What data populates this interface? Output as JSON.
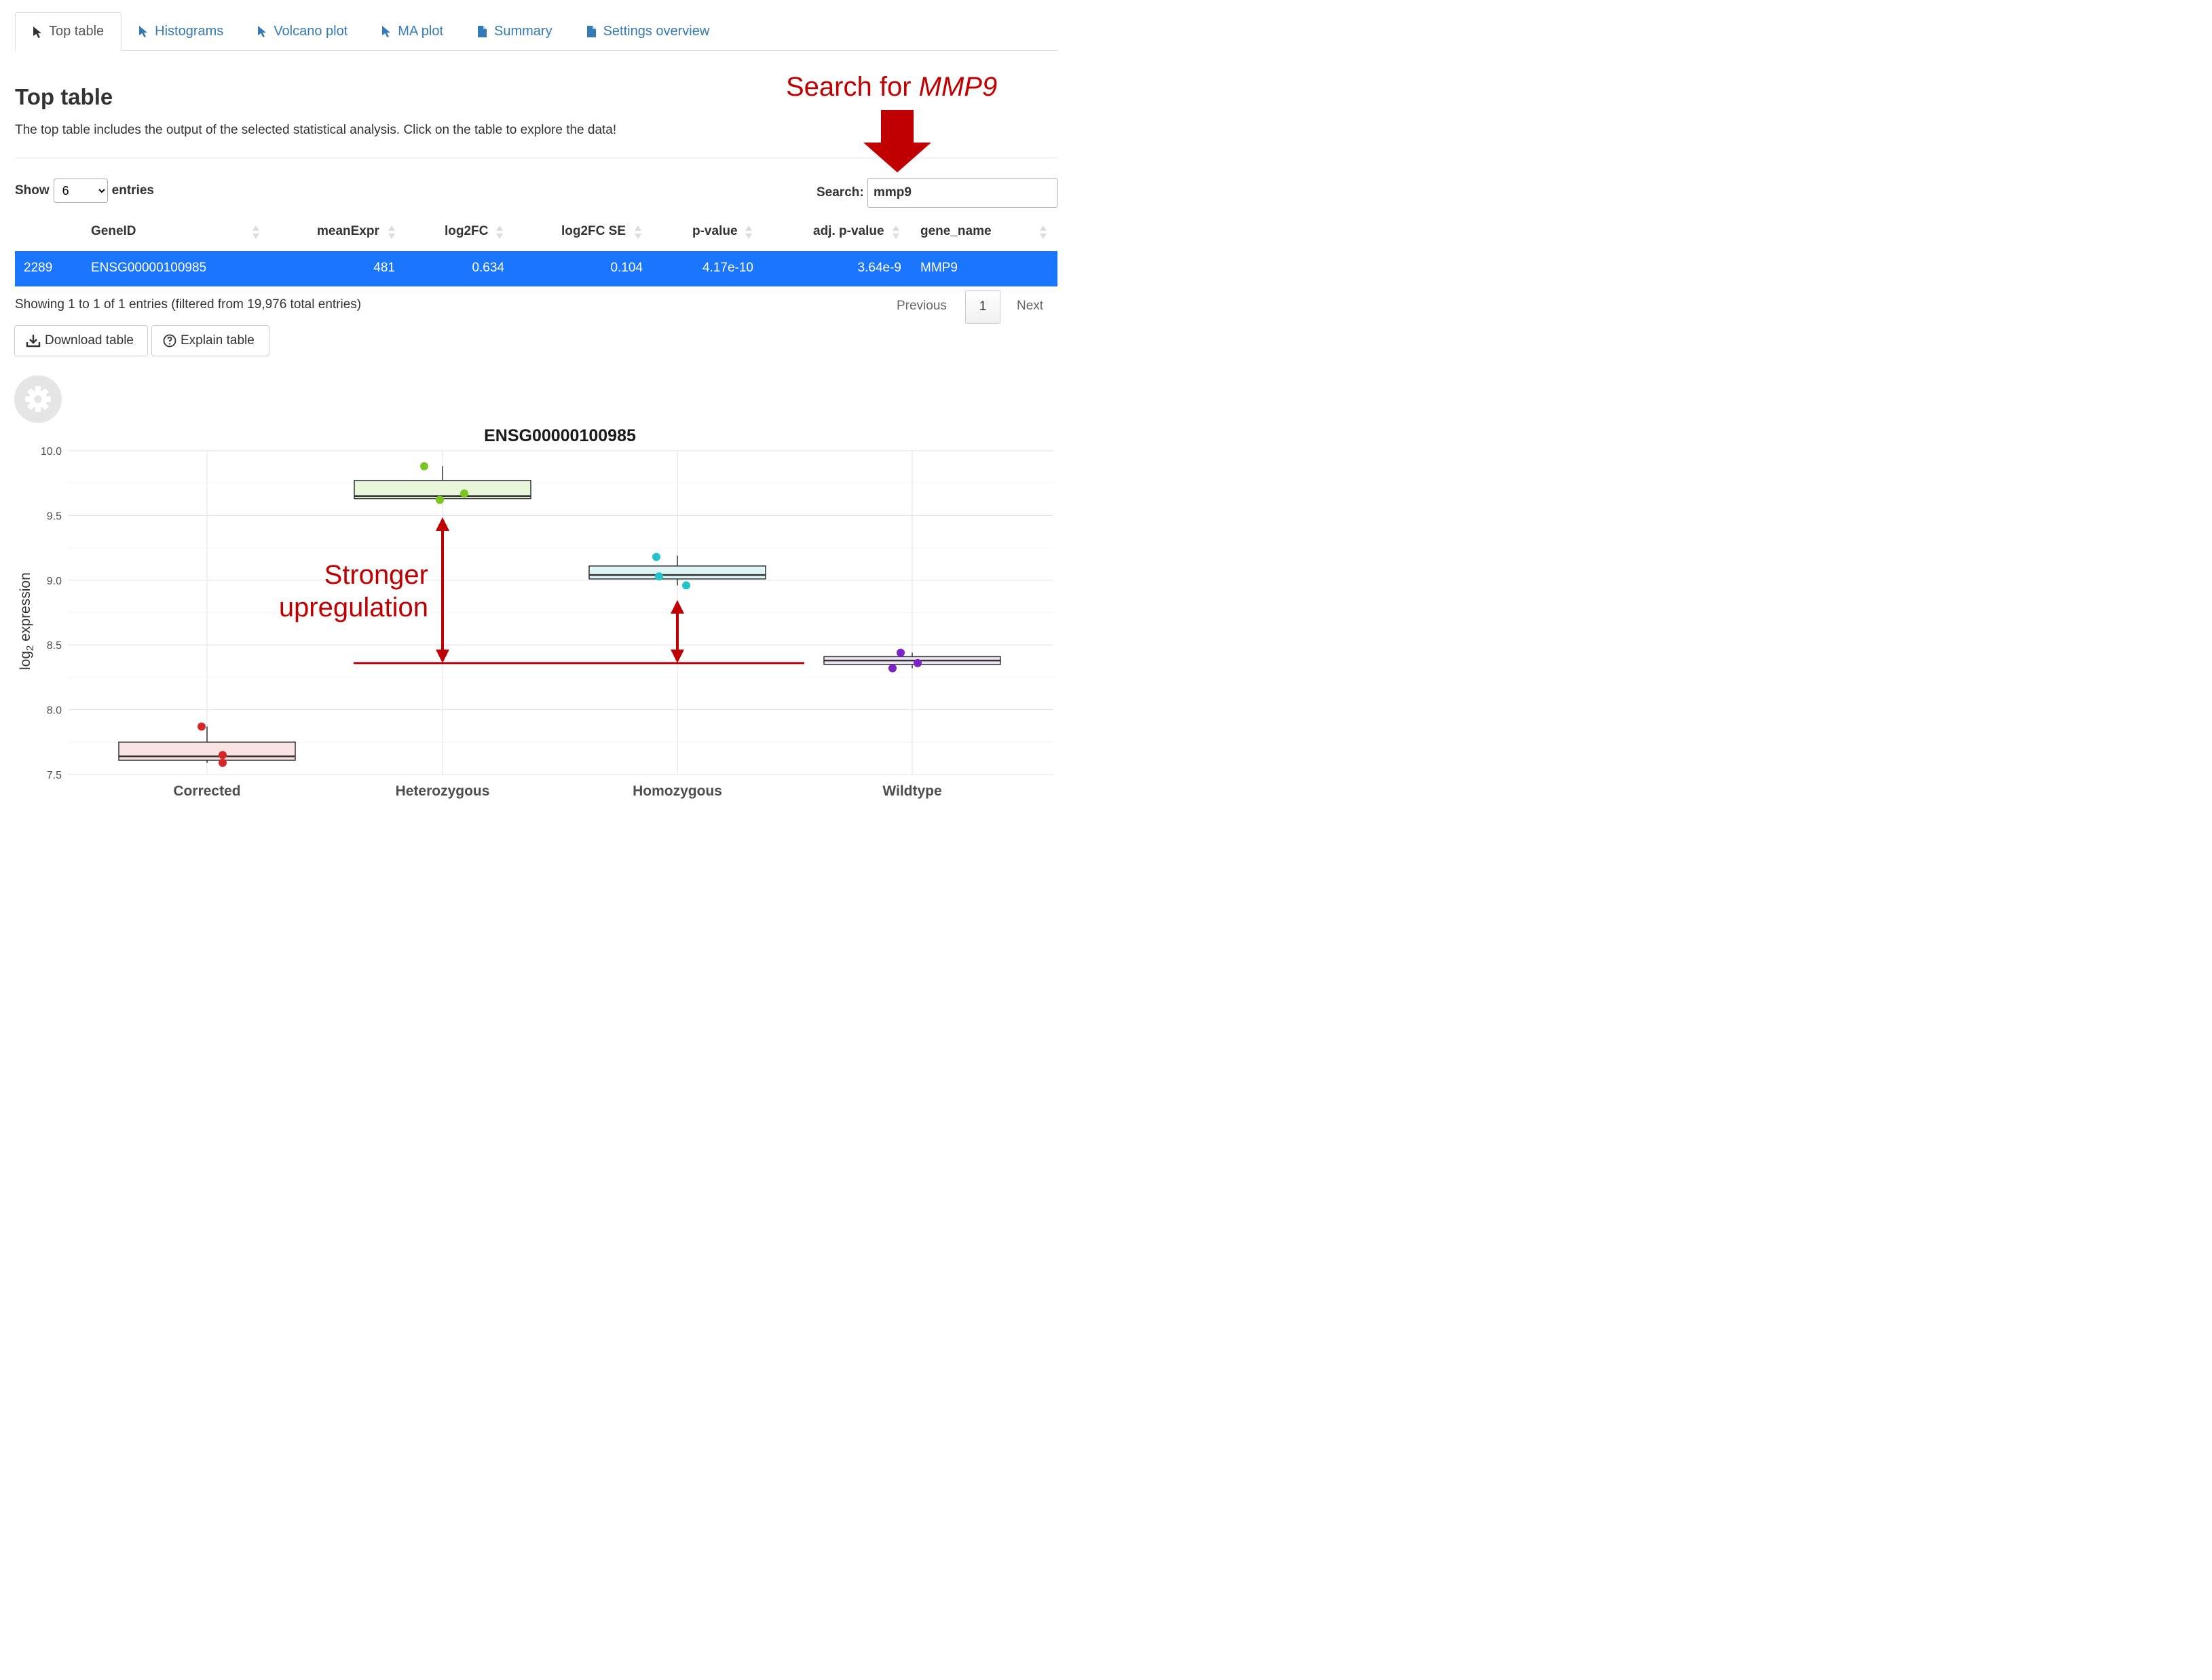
{
  "tabs": [
    {
      "label": "Top table",
      "icon": "cursor-icon",
      "active": true
    },
    {
      "label": "Histograms",
      "icon": "cursor-icon",
      "active": false
    },
    {
      "label": "Volcano plot",
      "icon": "cursor-icon",
      "active": false
    },
    {
      "label": "MA plot",
      "icon": "cursor-icon",
      "active": false
    },
    {
      "label": "Summary",
      "icon": "file-icon",
      "active": false
    },
    {
      "label": "Settings overview",
      "icon": "file-icon",
      "active": false
    }
  ],
  "page": {
    "title": "Top table",
    "description": "The top table includes the output of the selected statistical analysis. Click on the table to explore the data!"
  },
  "annotation": {
    "search_prefix": "Search for ",
    "search_gene": "MMP9",
    "upregulation_line1": "Stronger",
    "upregulation_line2": "upregulation",
    "color": "#c00000"
  },
  "table_controls": {
    "show_label": "Show",
    "entries_value": "6",
    "entries_label": "entries",
    "search_label": "Search:",
    "search_value": "mmp9"
  },
  "table": {
    "columns": [
      "GeneID",
      "meanExpr",
      "log2FC",
      "log2FC SE",
      "p-value",
      "adj. p-value",
      "gene_name"
    ],
    "rows": [
      {
        "index": "2289",
        "GeneID": "ENSG00000100985",
        "meanExpr": "481",
        "log2FC": "0.634",
        "log2FC_SE": "0.104",
        "p_value": "4.17e-10",
        "adj_p_value": "3.64e-9",
        "gene_name": "MMP9"
      }
    ],
    "selected_row_color": "#1a75ff",
    "info": "Showing 1 to 1 of 1 entries (filtered from 19,976 total entries)",
    "pagination": {
      "previous": "Previous",
      "page": "1",
      "next": "Next"
    }
  },
  "buttons": {
    "download": "Download table",
    "explain": "Explain table"
  },
  "chart_data": {
    "type": "box",
    "title": "ENSG00000100985",
    "xlabel": "",
    "ylabel": "log2 expression",
    "ylim": [
      7.5,
      10.0
    ],
    "yticks": [
      "7.5",
      "8.0",
      "8.5",
      "9.0",
      "9.5",
      "10.0"
    ],
    "grid": true,
    "categories": [
      "Corrected",
      "Heterozygous",
      "Homozygous",
      "Wildtype"
    ],
    "boxes": [
      {
        "q1": 7.61,
        "median": 7.64,
        "q3": 7.75,
        "min": 7.59,
        "max": 7.87,
        "points": [
          7.87,
          7.65,
          7.59
        ],
        "color": "#d62728",
        "fill": "#fbe3e3"
      },
      {
        "q1": 9.63,
        "median": 9.65,
        "q3": 9.77,
        "min": 9.62,
        "max": 9.88,
        "points": [
          9.88,
          9.62,
          9.67
        ],
        "color": "#7cc520",
        "fill": "#eaf6dc"
      },
      {
        "q1": 9.01,
        "median": 9.04,
        "q3": 9.11,
        "min": 8.96,
        "max": 9.19,
        "points": [
          9.18,
          9.03,
          8.96
        ],
        "color": "#22c3cc",
        "fill": "#def5f6"
      },
      {
        "q1": 8.35,
        "median": 8.38,
        "q3": 8.41,
        "min": 8.32,
        "max": 8.44,
        "points": [
          8.44,
          8.32,
          8.36
        ],
        "color": "#7b22c9",
        "fill": "#ece3f6"
      }
    ],
    "reference_level": 8.36
  }
}
